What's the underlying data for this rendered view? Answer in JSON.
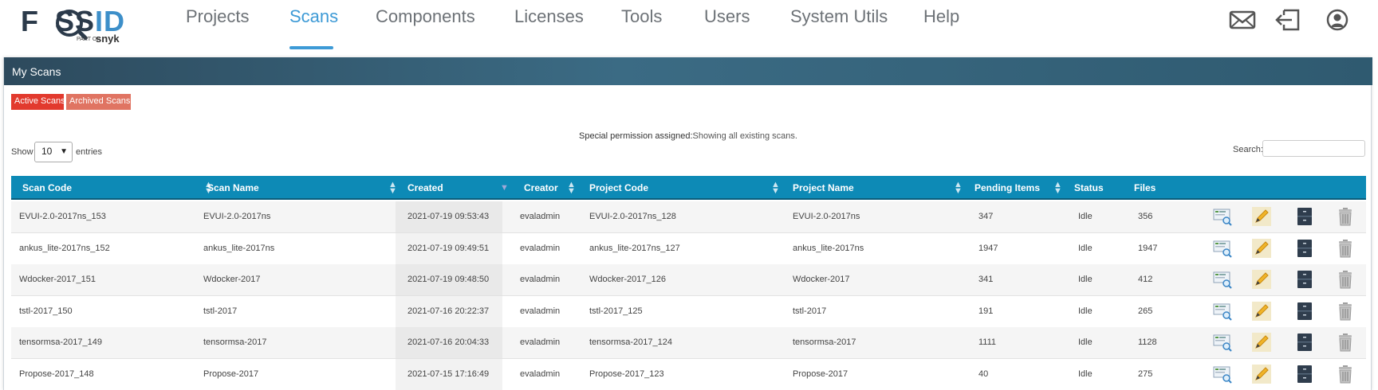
{
  "brand": {
    "logo_text": "FOSSID",
    "part_of": "PART OF",
    "parent": "snyk"
  },
  "nav": {
    "items": [
      {
        "label": "Projects",
        "active": false
      },
      {
        "label": "Scans",
        "active": true
      },
      {
        "label": "Components",
        "active": false
      },
      {
        "label": "Licenses",
        "active": false
      },
      {
        "label": "Tools",
        "active": false
      },
      {
        "label": "Users",
        "active": false
      },
      {
        "label": "System Utils",
        "active": false
      },
      {
        "label": "Help",
        "active": false
      }
    ],
    "icons": [
      "mail-icon",
      "logout-icon",
      "user-profile-icon"
    ],
    "active_color": "#3d9ad6"
  },
  "panel": {
    "title": "My Scans",
    "tabs": {
      "active": "Active Scans",
      "archived": "Archived Scans"
    },
    "permission_note": "Special permission assigned:",
    "permission_note_sub": "Showing all existing scans.",
    "show_label": "Show",
    "entries_value": "10",
    "entries_label": "entries",
    "search_label": "Search:",
    "search_value": ""
  },
  "table": {
    "header_color": "#0d8ab6",
    "columns": [
      "Scan Code",
      "Scan Name",
      "Created",
      "Creator",
      "Project Code",
      "Project Name",
      "Pending Items",
      "Status",
      "Files"
    ],
    "sorted_by": "Created",
    "rows": [
      [
        "EVUI-2.0-2017ns_153",
        "EVUI-2.0-2017ns",
        "2021-07-19 09:53:43",
        "evaladmin",
        "EVUI-2.0-2017ns_128",
        "EVUI-2.0-2017ns",
        "347",
        "Idle",
        "356"
      ],
      [
        "ankus_lite-2017ns_152",
        "ankus_lite-2017ns",
        "2021-07-19 09:49:51",
        "evaladmin",
        "ankus_lite-2017ns_127",
        "ankus_lite-2017ns",
        "1947",
        "Idle",
        "1947"
      ],
      [
        "Wdocker-2017_151",
        "Wdocker-2017",
        "2021-07-19 09:48:50",
        "evaladmin",
        "Wdocker-2017_126",
        "Wdocker-2017",
        "341",
        "Idle",
        "412"
      ],
      [
        "tstl-2017_150",
        "tstl-2017",
        "2021-07-16 20:22:37",
        "evaladmin",
        "tstl-2017_125",
        "tstl-2017",
        "191",
        "Idle",
        "265"
      ],
      [
        "tensormsa-2017_149",
        "tensormsa-2017",
        "2021-07-16 20:04:33",
        "evaladmin",
        "tensormsa-2017_124",
        "tensormsa-2017",
        "1111",
        "Idle",
        "1128"
      ],
      [
        "Propose-2017_148",
        "Propose-2017",
        "2021-07-15 17:16:49",
        "evaladmin",
        "Propose-2017_123",
        "Propose-2017",
        "40",
        "Idle",
        "275"
      ]
    ],
    "row_actions": [
      "view-report-icon",
      "edit-pencil-icon",
      "archive-cabinet-icon",
      "trash-icon"
    ]
  }
}
